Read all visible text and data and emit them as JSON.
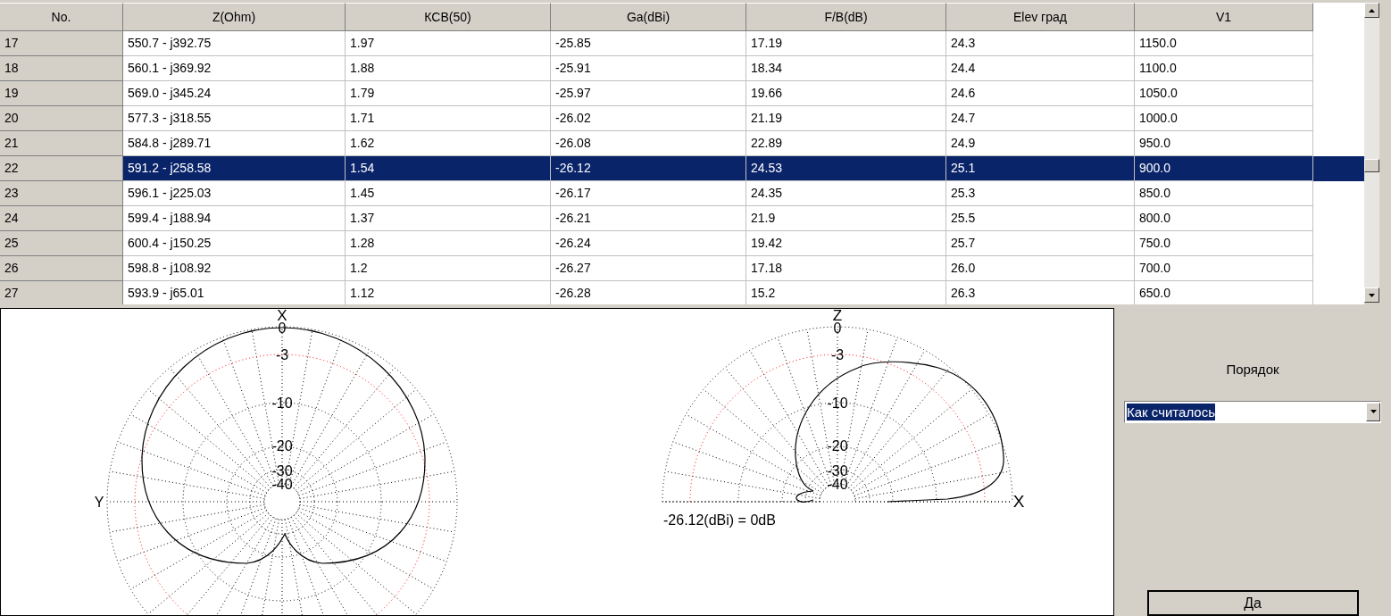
{
  "table": {
    "columns": [
      "No.",
      "Z(Ohm)",
      "КСВ(50)",
      "Ga(dBi)",
      "F/B(dB)",
      "Elev град",
      "V1"
    ],
    "rows": [
      {
        "cells": [
          "17",
          "550.7 - j392.75",
          "1.97",
          "-25.85",
          "17.19",
          "24.3",
          "1150.0"
        ],
        "selected": false
      },
      {
        "cells": [
          "18",
          "560.1 - j369.92",
          "1.88",
          "-25.91",
          "18.34",
          "24.4",
          "1100.0"
        ],
        "selected": false
      },
      {
        "cells": [
          "19",
          "569.0 - j345.24",
          "1.79",
          "-25.97",
          "19.66",
          "24.6",
          "1050.0"
        ],
        "selected": false
      },
      {
        "cells": [
          "20",
          "577.3 - j318.55",
          "1.71",
          "-26.02",
          "21.19",
          "24.7",
          "1000.0"
        ],
        "selected": false
      },
      {
        "cells": [
          "21",
          "584.8 - j289.71",
          "1.62",
          "-26.08",
          "22.89",
          "24.9",
          "950.0"
        ],
        "selected": false
      },
      {
        "cells": [
          "22",
          "591.2 - j258.58",
          "1.54",
          "-26.12",
          "24.53",
          "25.1",
          "900.0"
        ],
        "selected": true
      },
      {
        "cells": [
          "23",
          "596.1 - j225.03",
          "1.45",
          "-26.17",
          "24.35",
          "25.3",
          "850.0"
        ],
        "selected": false
      },
      {
        "cells": [
          "24",
          "599.4 - j188.94",
          "1.37",
          "-26.21",
          "21.9",
          "25.5",
          "800.0"
        ],
        "selected": false
      },
      {
        "cells": [
          "25",
          "600.4 - j150.25",
          "1.28",
          "-26.24",
          "19.42",
          "25.7",
          "750.0"
        ],
        "selected": false
      },
      {
        "cells": [
          "26",
          "598.8 - j108.92",
          "1.2",
          "-26.27",
          "17.18",
          "26.0",
          "700.0"
        ],
        "selected": false
      },
      {
        "cells": [
          "27",
          "593.9 - j65.01",
          "1.12",
          "-26.28",
          "15.2",
          "26.3",
          "650.0"
        ],
        "selected": false
      }
    ]
  },
  "azimuth_plot": {
    "axis_top": "X",
    "axis_left": "Y",
    "ring_labels": [
      "0",
      "-3",
      "-10",
      "-20",
      "-30",
      "-40"
    ]
  },
  "elevation_plot": {
    "axis_top": "Z",
    "axis_right": "X",
    "ring_labels": [
      "0",
      "-3",
      "-10",
      "-20",
      "-30",
      "-40"
    ],
    "caption": "-26.12(dBi) = 0dB"
  },
  "order": {
    "label": "Порядок",
    "value": "Как считалось"
  },
  "ok_button": "Да"
}
